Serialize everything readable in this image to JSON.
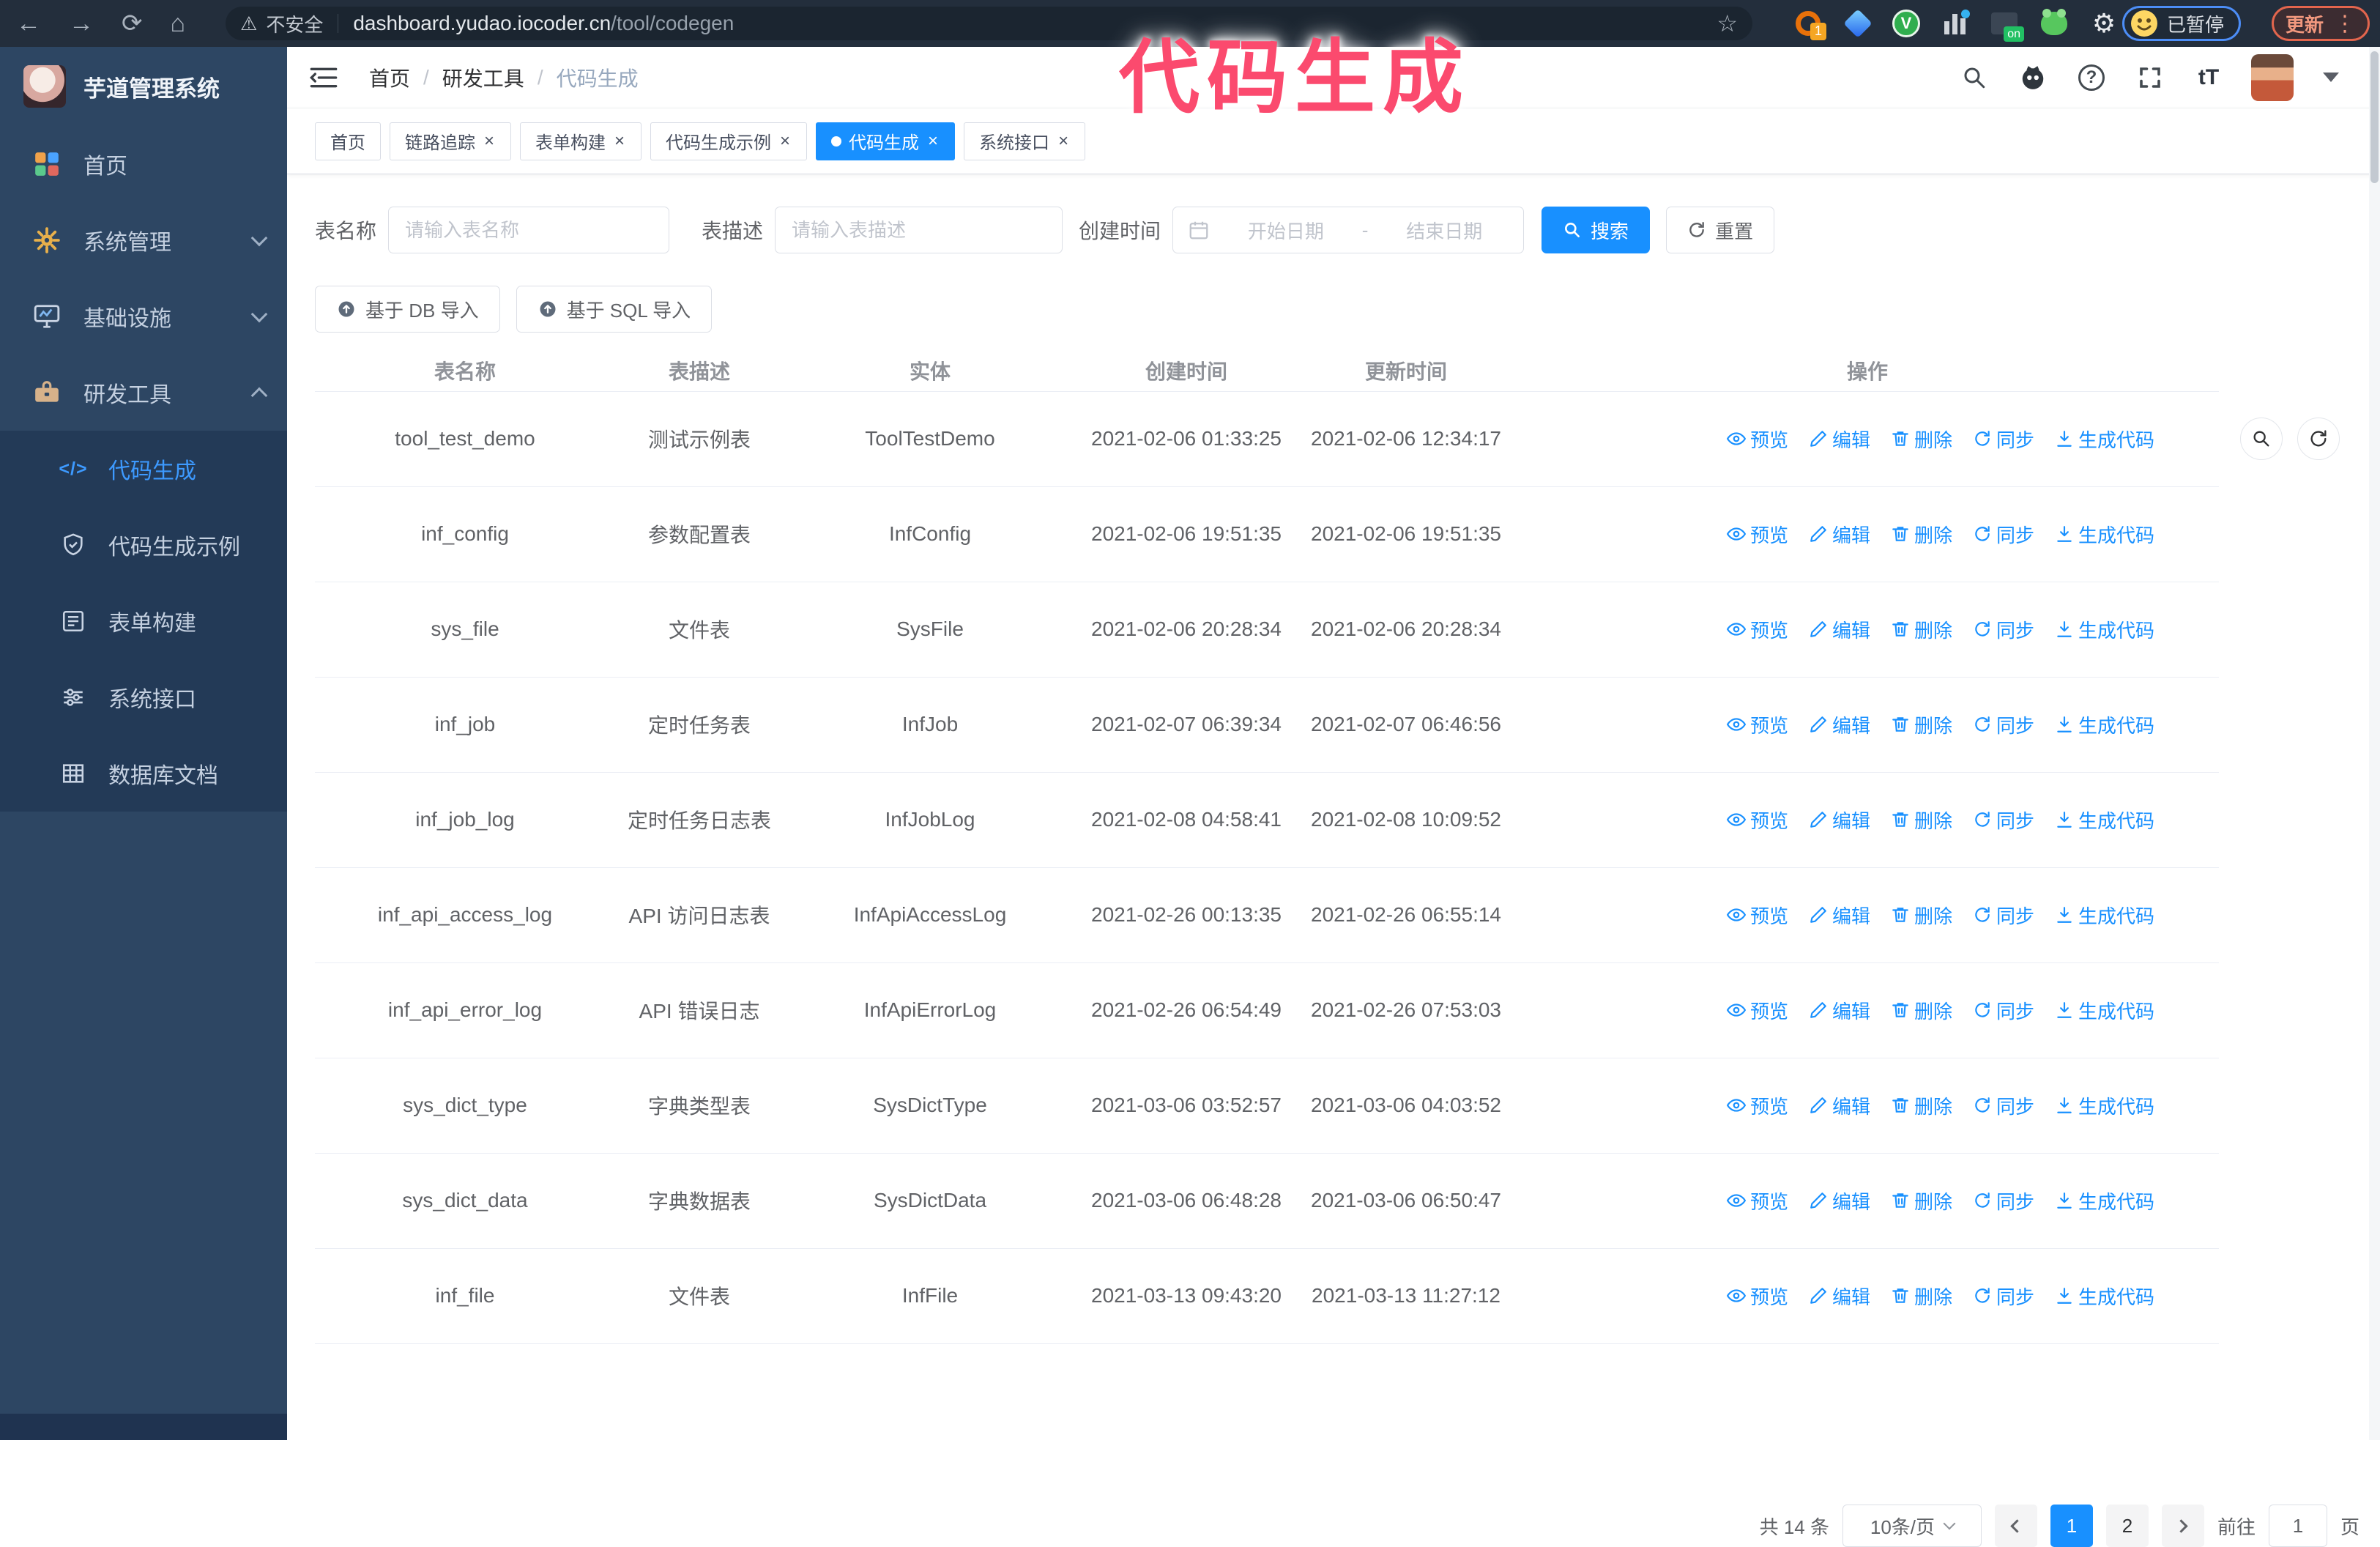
{
  "colors": {
    "accent": "#1890ff",
    "sidebar_bg": "#2d4663",
    "submenu_bg": "#233a57",
    "annotation": "#fb4a6e",
    "browser_bg": "#232e3c"
  },
  "browser": {
    "security_label": "不安全",
    "url_host": "dashboard.yudao.iocoder.cn",
    "url_path": "/tool/codegen",
    "ext_badge_count": "1",
    "ext_on_label": "on",
    "paused_label": "已暂停",
    "update_label": "更新"
  },
  "annotation": {
    "text": "代码生成"
  },
  "app": {
    "title": "芋道管理系统"
  },
  "header": {
    "breadcrumb": [
      "首页",
      "研发工具",
      "代码生成"
    ],
    "breadcrumb_separator": "/"
  },
  "tabs": [
    {
      "label": "首页",
      "closable": false,
      "active": false
    },
    {
      "label": "链路追踪",
      "closable": true,
      "active": false
    },
    {
      "label": "表单构建",
      "closable": true,
      "active": false
    },
    {
      "label": "代码生成示例",
      "closable": true,
      "active": false
    },
    {
      "label": "代码生成",
      "closable": true,
      "active": true
    },
    {
      "label": "系统接口",
      "closable": true,
      "active": false
    }
  ],
  "sidebar": {
    "items": [
      {
        "label": "首页"
      },
      {
        "label": "系统管理"
      },
      {
        "label": "基础设施"
      },
      {
        "label": "研发工具"
      }
    ],
    "submenu": [
      {
        "label": "代码生成",
        "active": true
      },
      {
        "label": "代码生成示例",
        "active": false
      },
      {
        "label": "表单构建",
        "active": false
      },
      {
        "label": "系统接口",
        "active": false
      },
      {
        "label": "数据库文档",
        "active": false
      }
    ]
  },
  "search": {
    "name_label": "表名称",
    "name_placeholder": "请输入表名称",
    "desc_label": "表描述",
    "desc_placeholder": "请输入表描述",
    "time_label": "创建时间",
    "start_placeholder": "开始日期",
    "range_separator": "-",
    "end_placeholder": "结束日期",
    "search_button": "搜索",
    "reset_button": "重置"
  },
  "toolbar": {
    "import_db": "基于 DB 导入",
    "import_sql": "基于 SQL 导入"
  },
  "table": {
    "columns": [
      "表名称",
      "表描述",
      "实体",
      "创建时间",
      "更新时间",
      "操作"
    ],
    "actions": [
      {
        "name": "preview",
        "label": "预览"
      },
      {
        "name": "edit",
        "label": "编辑"
      },
      {
        "name": "delete",
        "label": "删除"
      },
      {
        "name": "sync",
        "label": "同步"
      },
      {
        "name": "generate-code",
        "label": "生成代码"
      }
    ],
    "rows": [
      [
        "tool_test_demo",
        "测试示例表",
        "ToolTestDemo",
        "2021-02-06 01:33:25",
        "2021-02-06 12:34:17"
      ],
      [
        "inf_config",
        "参数配置表",
        "InfConfig",
        "2021-02-06 19:51:35",
        "2021-02-06 19:51:35"
      ],
      [
        "sys_file",
        "文件表",
        "SysFile",
        "2021-02-06 20:28:34",
        "2021-02-06 20:28:34"
      ],
      [
        "inf_job",
        "定时任务表",
        "InfJob",
        "2021-02-07 06:39:34",
        "2021-02-07 06:46:56"
      ],
      [
        "inf_job_log",
        "定时任务日志表",
        "InfJobLog",
        "2021-02-08 04:58:41",
        "2021-02-08 10:09:52"
      ],
      [
        "inf_api_access_log",
        "API 访问日志表",
        "InfApiAccessLog",
        "2021-02-26 00:13:35",
        "2021-02-26 06:55:14"
      ],
      [
        "inf_api_error_log",
        "API 错误日志",
        "InfApiErrorLog",
        "2021-02-26 06:54:49",
        "2021-02-26 07:53:03"
      ],
      [
        "sys_dict_type",
        "字典类型表",
        "SysDictType",
        "2021-03-06 03:52:57",
        "2021-03-06 04:03:52"
      ],
      [
        "sys_dict_data",
        "字典数据表",
        "SysDictData",
        "2021-03-06 06:48:28",
        "2021-03-06 06:50:47"
      ],
      [
        "inf_file",
        "文件表",
        "InfFile",
        "2021-03-13 09:43:20",
        "2021-03-13 11:27:12"
      ]
    ]
  },
  "pagination": {
    "total_text": "共 14 条",
    "page_size": "10条/页",
    "pages": [
      "1",
      "2"
    ],
    "active_page": "1",
    "goto_label": "前往",
    "goto_value": "1",
    "page_suffix": "页"
  }
}
